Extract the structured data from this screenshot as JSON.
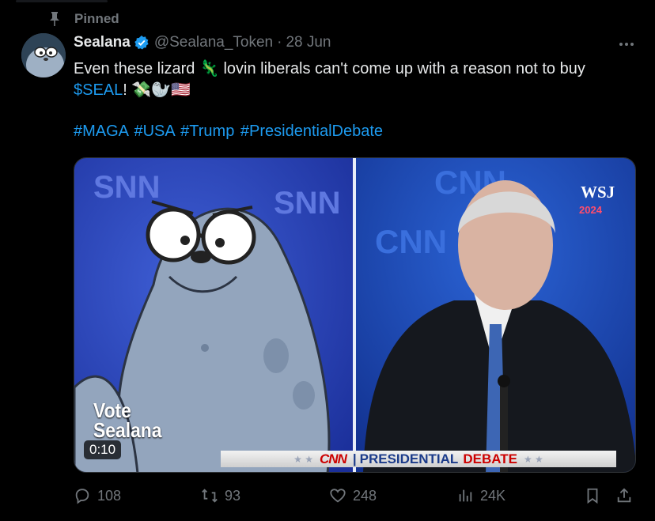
{
  "pinned_label": "Pinned",
  "author": {
    "name": "Sealana",
    "handle": "@Sealana_Token",
    "separator": "·",
    "date": "28 Jun"
  },
  "tweet": {
    "text_part1": "Even these lizard",
    "emoji_lizard": "🦎",
    "text_part2": "lovin liberals can't come up with a reason not to buy",
    "cashtag": "$SEAL",
    "text_part3": "!",
    "emojis_end": "💸🦭🇺🇸",
    "hashtags": "#MAGA #USA #Trump #PresidentialDebate"
  },
  "media": {
    "overlay_text_line1": "Vote",
    "overlay_text_line2": "Sealana",
    "duration": "0:10",
    "banner_logo": "CNN",
    "banner_separator": "|",
    "banner_presidential": "PRESIDENTIAL",
    "banner_debate": "DEBATE",
    "banner_stars": "★ ★",
    "left_watermark": "SNN",
    "right_watermark": "CNN",
    "wsj_logo": "WSJ",
    "wsj_year": "2024"
  },
  "actions": {
    "replies": "108",
    "reposts": "93",
    "likes": "248",
    "views": "24K"
  },
  "icons": {
    "pin": "pin-icon",
    "verified": "verified-badge-icon",
    "more": "more-icon",
    "reply": "reply-icon",
    "repost": "repost-icon",
    "like": "heart-icon",
    "views": "views-icon",
    "bookmark": "bookmark-icon",
    "share": "share-icon"
  },
  "colors": {
    "accent": "#1d9bf0",
    "muted": "#71767b",
    "background": "#000000"
  }
}
